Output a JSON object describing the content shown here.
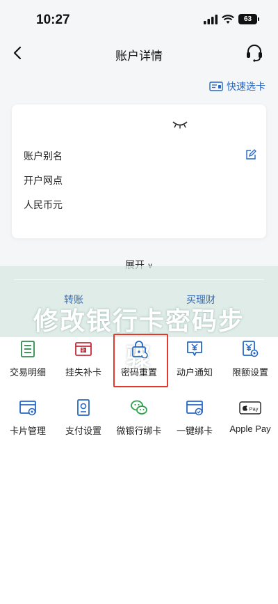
{
  "status": {
    "time": "10:27",
    "battery": "63"
  },
  "nav": {
    "title": "账户详情"
  },
  "quick_card": {
    "label": "快速选卡"
  },
  "card": {
    "rows": [
      "账户别名",
      "开户网点",
      "人民币元"
    ]
  },
  "expand": {
    "label": "展开"
  },
  "actions": {
    "transfer": "转账",
    "buy": "买理财"
  },
  "banner": {
    "text": "修改银行卡密码步骤"
  },
  "grid": {
    "row1": [
      "交易明细",
      "挂失补卡",
      "密码重置",
      "动户通知",
      "限额设置"
    ],
    "row2": [
      "卡片管理",
      "支付设置",
      "微银行绑卡",
      "一键绑卡",
      "Apple Pay"
    ]
  },
  "colors": {
    "accent": "#2467c7",
    "highlight": "#e23a2a",
    "wechat": "#2aa04a",
    "report": "#c72b3b"
  }
}
